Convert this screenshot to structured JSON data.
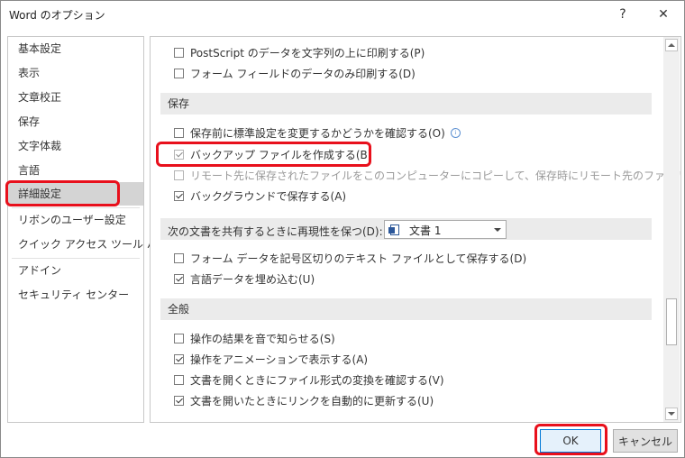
{
  "window": {
    "title": "Word のオプション",
    "help": "?",
    "close": "✕"
  },
  "sidebar": {
    "items": [
      {
        "label": "基本設定"
      },
      {
        "label": "表示"
      },
      {
        "label": "文章校正"
      },
      {
        "label": "保存"
      },
      {
        "label": "文字体裁"
      },
      {
        "label": "言語"
      },
      {
        "label": "詳細設定",
        "active": true
      },
      {
        "label": "リボンのユーザー設定"
      },
      {
        "label": "クイック アクセス ツール バー"
      },
      {
        "label": "アドイン"
      },
      {
        "label": "セキュリティ センター"
      }
    ]
  },
  "print_options": [
    {
      "label": "PostScript のデータを文字列の上に印刷する(P)",
      "checked": false
    },
    {
      "label": "フォーム フィールドのデータのみ印刷する(D)",
      "checked": false
    }
  ],
  "save_section": {
    "heading": "保存",
    "options": [
      {
        "label": "保存前に標準設定を変更するかどうかを確認する(O)",
        "checked": false,
        "info": "i"
      },
      {
        "label": "バックアップ ファイルを作成する(B)",
        "checked": true,
        "disabled": true
      },
      {
        "label": "リモート先に保存されたファイルをこのコンピューターにコピーして、保存時にリモート先のファイルを更新する(E)",
        "checked": false,
        "disabled": true
      },
      {
        "label": "バックグラウンドで保存する(A)",
        "checked": true
      }
    ]
  },
  "share_section": {
    "label": "次の文書を共有するときに再現性を保つ(D):",
    "selected_document": "文書 1",
    "options": [
      {
        "label": "フォーム データを記号区切りのテキスト ファイルとして保存する(D)",
        "checked": false
      },
      {
        "label": "言語データを埋め込む(U)",
        "checked": true
      }
    ]
  },
  "general_section": {
    "heading": "全般",
    "options": [
      {
        "label": "操作の結果を音で知らせる(S)",
        "checked": false
      },
      {
        "label": "操作をアニメーションで表示する(A)",
        "checked": true
      },
      {
        "label": "文書を開くときにファイル形式の変換を確認する(V)",
        "checked": false
      },
      {
        "label": "文書を開いたときにリンクを自動的に更新する(U)",
        "checked": true
      }
    ]
  },
  "buttons": {
    "ok": "OK",
    "cancel": "キャンセル"
  },
  "colors": {
    "highlight": "#e8101c",
    "selected_nav": "#d4d4d4",
    "section_bg": "#ebebeb"
  }
}
